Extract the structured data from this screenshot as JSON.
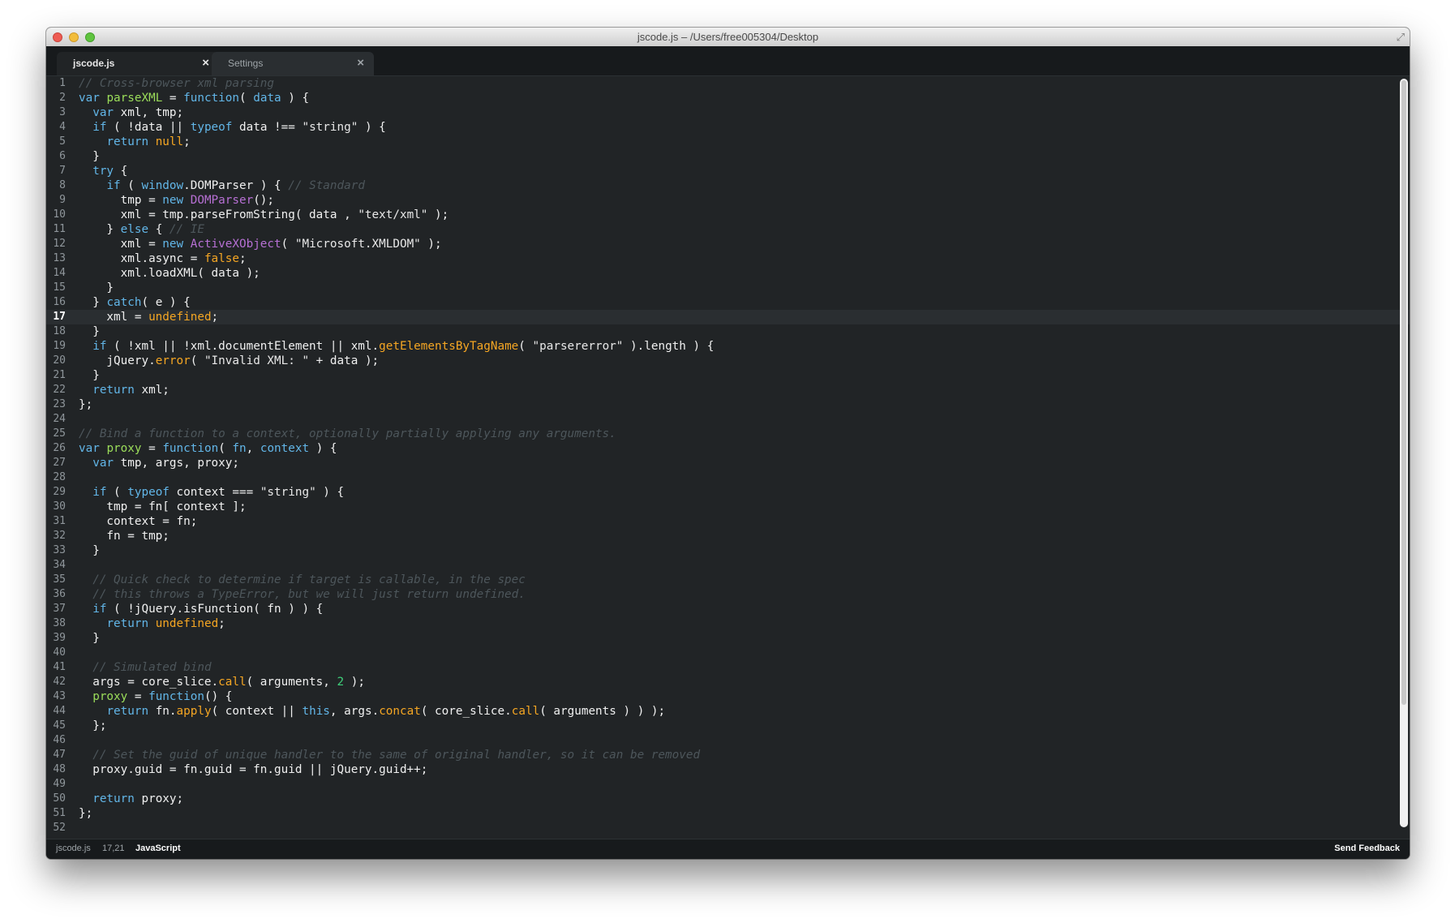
{
  "window": {
    "title": "jscode.js – /Users/free005304/Desktop"
  },
  "tabs": [
    {
      "label": "jscode.js",
      "close": "×",
      "active": true
    },
    {
      "label": "Settings",
      "close": "×",
      "active": false
    }
  ],
  "status": {
    "file": "jscode.js",
    "position": "17,21",
    "language": "JavaScript",
    "feedback": "Send Feedback"
  },
  "editor": {
    "current_line": 17,
    "colors": {
      "background": "#212426",
      "keyword": "#62b6e8",
      "function": "#9bdd5a",
      "comment": "#4d565b",
      "constant": "#f5a623",
      "class": "#b770d4",
      "number": "#3fd07a"
    },
    "lines": [
      [
        [
          "comment",
          "// Cross-browser xml parsing"
        ]
      ],
      [
        [
          "keyword",
          "var"
        ],
        [
          "plain",
          " "
        ],
        [
          "function",
          "parseXML"
        ],
        [
          "plain",
          " = "
        ],
        [
          "keyword",
          "function"
        ],
        [
          "plain",
          "( "
        ],
        [
          "param",
          "data"
        ],
        [
          "plain",
          " ) {"
        ]
      ],
      [
        [
          "plain",
          "  "
        ],
        [
          "keyword",
          "var"
        ],
        [
          "plain",
          " xml, tmp;"
        ]
      ],
      [
        [
          "plain",
          "  "
        ],
        [
          "keyword",
          "if"
        ],
        [
          "plain",
          " ( !data || "
        ],
        [
          "keyword",
          "typeof"
        ],
        [
          "plain",
          " data !== "
        ],
        [
          "string",
          "\"string\""
        ],
        [
          "plain",
          " ) {"
        ]
      ],
      [
        [
          "plain",
          "    "
        ],
        [
          "keyword",
          "return"
        ],
        [
          "plain",
          " "
        ],
        [
          "constant",
          "null"
        ],
        [
          "plain",
          ";"
        ]
      ],
      [
        [
          "plain",
          "  }"
        ]
      ],
      [
        [
          "plain",
          "  "
        ],
        [
          "keyword",
          "try"
        ],
        [
          "plain",
          " {"
        ]
      ],
      [
        [
          "plain",
          "    "
        ],
        [
          "keyword",
          "if"
        ],
        [
          "plain",
          " ( "
        ],
        [
          "keyword",
          "window"
        ],
        [
          "plain",
          ".DOMParser ) { "
        ],
        [
          "comment",
          "// Standard"
        ]
      ],
      [
        [
          "plain",
          "      tmp = "
        ],
        [
          "keyword",
          "new"
        ],
        [
          "plain",
          " "
        ],
        [
          "class",
          "DOMParser"
        ],
        [
          "plain",
          "();"
        ]
      ],
      [
        [
          "plain",
          "      xml = tmp.parseFromString( data , "
        ],
        [
          "string",
          "\"text/xml\""
        ],
        [
          "plain",
          " );"
        ]
      ],
      [
        [
          "plain",
          "    } "
        ],
        [
          "keyword",
          "else"
        ],
        [
          "plain",
          " { "
        ],
        [
          "comment",
          "// IE"
        ]
      ],
      [
        [
          "plain",
          "      xml = "
        ],
        [
          "keyword",
          "new"
        ],
        [
          "plain",
          " "
        ],
        [
          "class",
          "ActiveXObject"
        ],
        [
          "plain",
          "( "
        ],
        [
          "string",
          "\"Microsoft.XMLDOM\""
        ],
        [
          "plain",
          " );"
        ]
      ],
      [
        [
          "plain",
          "      xml.async = "
        ],
        [
          "constant",
          "false"
        ],
        [
          "plain",
          ";"
        ]
      ],
      [
        [
          "plain",
          "      xml.loadXML( data );"
        ]
      ],
      [
        [
          "plain",
          "    }"
        ]
      ],
      [
        [
          "plain",
          "  } "
        ],
        [
          "keyword",
          "catch"
        ],
        [
          "plain",
          "( e ) {"
        ]
      ],
      [
        [
          "plain",
          "    xml = "
        ],
        [
          "constant",
          "undefined"
        ],
        [
          "plain",
          ";"
        ]
      ],
      [
        [
          "plain",
          "  }"
        ]
      ],
      [
        [
          "plain",
          "  "
        ],
        [
          "keyword",
          "if"
        ],
        [
          "plain",
          " ( !xml || !xml.documentElement || xml."
        ],
        [
          "method",
          "getElementsByTagName"
        ],
        [
          "plain",
          "( "
        ],
        [
          "string",
          "\"parsererror\""
        ],
        [
          "plain",
          " ).length ) {"
        ]
      ],
      [
        [
          "plain",
          "    jQuery."
        ],
        [
          "method",
          "error"
        ],
        [
          "plain",
          "( "
        ],
        [
          "string",
          "\"Invalid XML: \""
        ],
        [
          "plain",
          " + data );"
        ]
      ],
      [
        [
          "plain",
          "  }"
        ]
      ],
      [
        [
          "plain",
          "  "
        ],
        [
          "keyword",
          "return"
        ],
        [
          "plain",
          " xml;"
        ]
      ],
      [
        [
          "plain",
          "};"
        ]
      ],
      [],
      [
        [
          "comment",
          "// Bind a function to a context, optionally partially applying any arguments."
        ]
      ],
      [
        [
          "keyword",
          "var"
        ],
        [
          "plain",
          " "
        ],
        [
          "function",
          "proxy"
        ],
        [
          "plain",
          " = "
        ],
        [
          "keyword",
          "function"
        ],
        [
          "plain",
          "( "
        ],
        [
          "param",
          "fn"
        ],
        [
          "plain",
          ", "
        ],
        [
          "param",
          "context"
        ],
        [
          "plain",
          " ) {"
        ]
      ],
      [
        [
          "plain",
          "  "
        ],
        [
          "keyword",
          "var"
        ],
        [
          "plain",
          " tmp, args, proxy;"
        ]
      ],
      [],
      [
        [
          "plain",
          "  "
        ],
        [
          "keyword",
          "if"
        ],
        [
          "plain",
          " ( "
        ],
        [
          "keyword",
          "typeof"
        ],
        [
          "plain",
          " context === "
        ],
        [
          "string",
          "\"string\""
        ],
        [
          "plain",
          " ) {"
        ]
      ],
      [
        [
          "plain",
          "    tmp = fn[ context ];"
        ]
      ],
      [
        [
          "plain",
          "    context = fn;"
        ]
      ],
      [
        [
          "plain",
          "    fn = tmp;"
        ]
      ],
      [
        [
          "plain",
          "  }"
        ]
      ],
      [],
      [
        [
          "plain",
          "  "
        ],
        [
          "comment",
          "// Quick check to determine if target is callable, in the spec"
        ]
      ],
      [
        [
          "plain",
          "  "
        ],
        [
          "comment",
          "// this throws a TypeError, but we will just return undefined."
        ]
      ],
      [
        [
          "plain",
          "  "
        ],
        [
          "keyword",
          "if"
        ],
        [
          "plain",
          " ( !jQuery.isFunction( fn ) ) {"
        ]
      ],
      [
        [
          "plain",
          "    "
        ],
        [
          "keyword",
          "return"
        ],
        [
          "plain",
          " "
        ],
        [
          "constant",
          "undefined"
        ],
        [
          "plain",
          ";"
        ]
      ],
      [
        [
          "plain",
          "  }"
        ]
      ],
      [],
      [
        [
          "plain",
          "  "
        ],
        [
          "comment",
          "// Simulated bind"
        ]
      ],
      [
        [
          "plain",
          "  args = core_slice."
        ],
        [
          "method",
          "call"
        ],
        [
          "plain",
          "( arguments, "
        ],
        [
          "number",
          "2"
        ],
        [
          "plain",
          " );"
        ]
      ],
      [
        [
          "plain",
          "  "
        ],
        [
          "function",
          "proxy"
        ],
        [
          "plain",
          " = "
        ],
        [
          "keyword",
          "function"
        ],
        [
          "plain",
          "() {"
        ]
      ],
      [
        [
          "plain",
          "    "
        ],
        [
          "keyword",
          "return"
        ],
        [
          "plain",
          " fn."
        ],
        [
          "method",
          "apply"
        ],
        [
          "plain",
          "( context || "
        ],
        [
          "keyword",
          "this"
        ],
        [
          "plain",
          ", args."
        ],
        [
          "method",
          "concat"
        ],
        [
          "plain",
          "( core_slice."
        ],
        [
          "method",
          "call"
        ],
        [
          "plain",
          "( arguments ) ) );"
        ]
      ],
      [
        [
          "plain",
          "  };"
        ]
      ],
      [],
      [
        [
          "plain",
          "  "
        ],
        [
          "comment",
          "// Set the guid of unique handler to the same of original handler, so it can be removed"
        ]
      ],
      [
        [
          "plain",
          "  proxy.guid = fn.guid = fn.guid || jQuery.guid++;"
        ]
      ],
      [],
      [
        [
          "plain",
          "  "
        ],
        [
          "keyword",
          "return"
        ],
        [
          "plain",
          " proxy;"
        ]
      ],
      [
        [
          "plain",
          "};"
        ]
      ],
      []
    ]
  }
}
